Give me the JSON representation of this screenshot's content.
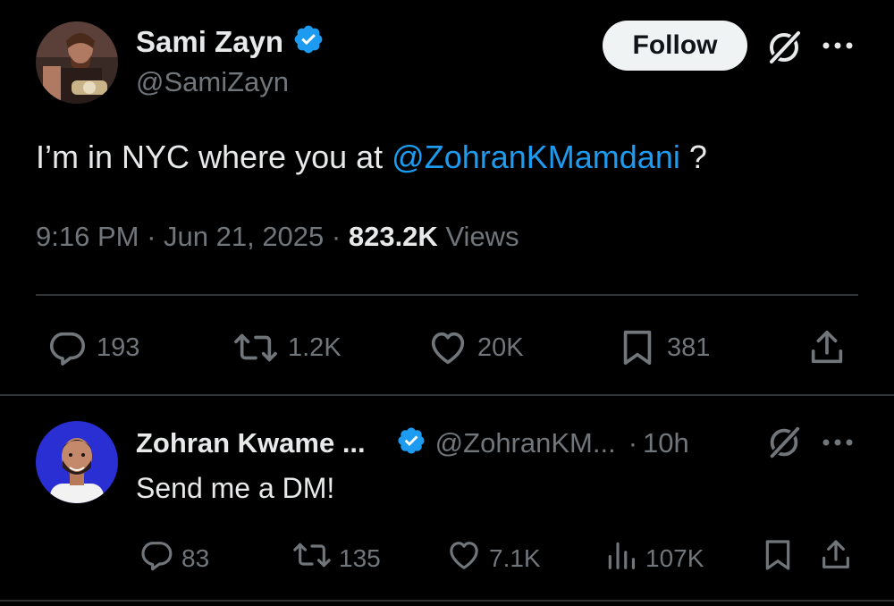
{
  "main_tweet": {
    "author_name": "Sami Zayn",
    "author_handle": "@SamiZayn",
    "follow_label": "Follow",
    "text_before": "I’m in NYC where you at ",
    "mention": "@ZohranKMamdani",
    "text_after": " ?",
    "time": "9:16 PM",
    "date": "Jun 21, 2025",
    "views_count": "823.2K",
    "views_label": "Views",
    "stats": {
      "replies": "193",
      "reposts": "1.2K",
      "likes": "20K",
      "bookmarks": "381"
    }
  },
  "reply": {
    "author_name": "Zohran Kwame ...",
    "author_handle": "@ZohranKM...",
    "separator": "·",
    "age": "10h",
    "text": "Send me a DM!",
    "stats": {
      "replies": "83",
      "reposts": "135",
      "likes": "7.1K",
      "views": "107K"
    }
  },
  "colors": {
    "background": "#000000",
    "text": "#e7e9ea",
    "secondary": "#71767b",
    "accent": "#1d9bf0",
    "divider": "#2f3336"
  },
  "icons": [
    "verified-badge-icon",
    "grok-icon",
    "more-icon",
    "reply-icon",
    "repost-icon",
    "like-icon",
    "bookmark-icon",
    "share-icon",
    "views-icon"
  ]
}
